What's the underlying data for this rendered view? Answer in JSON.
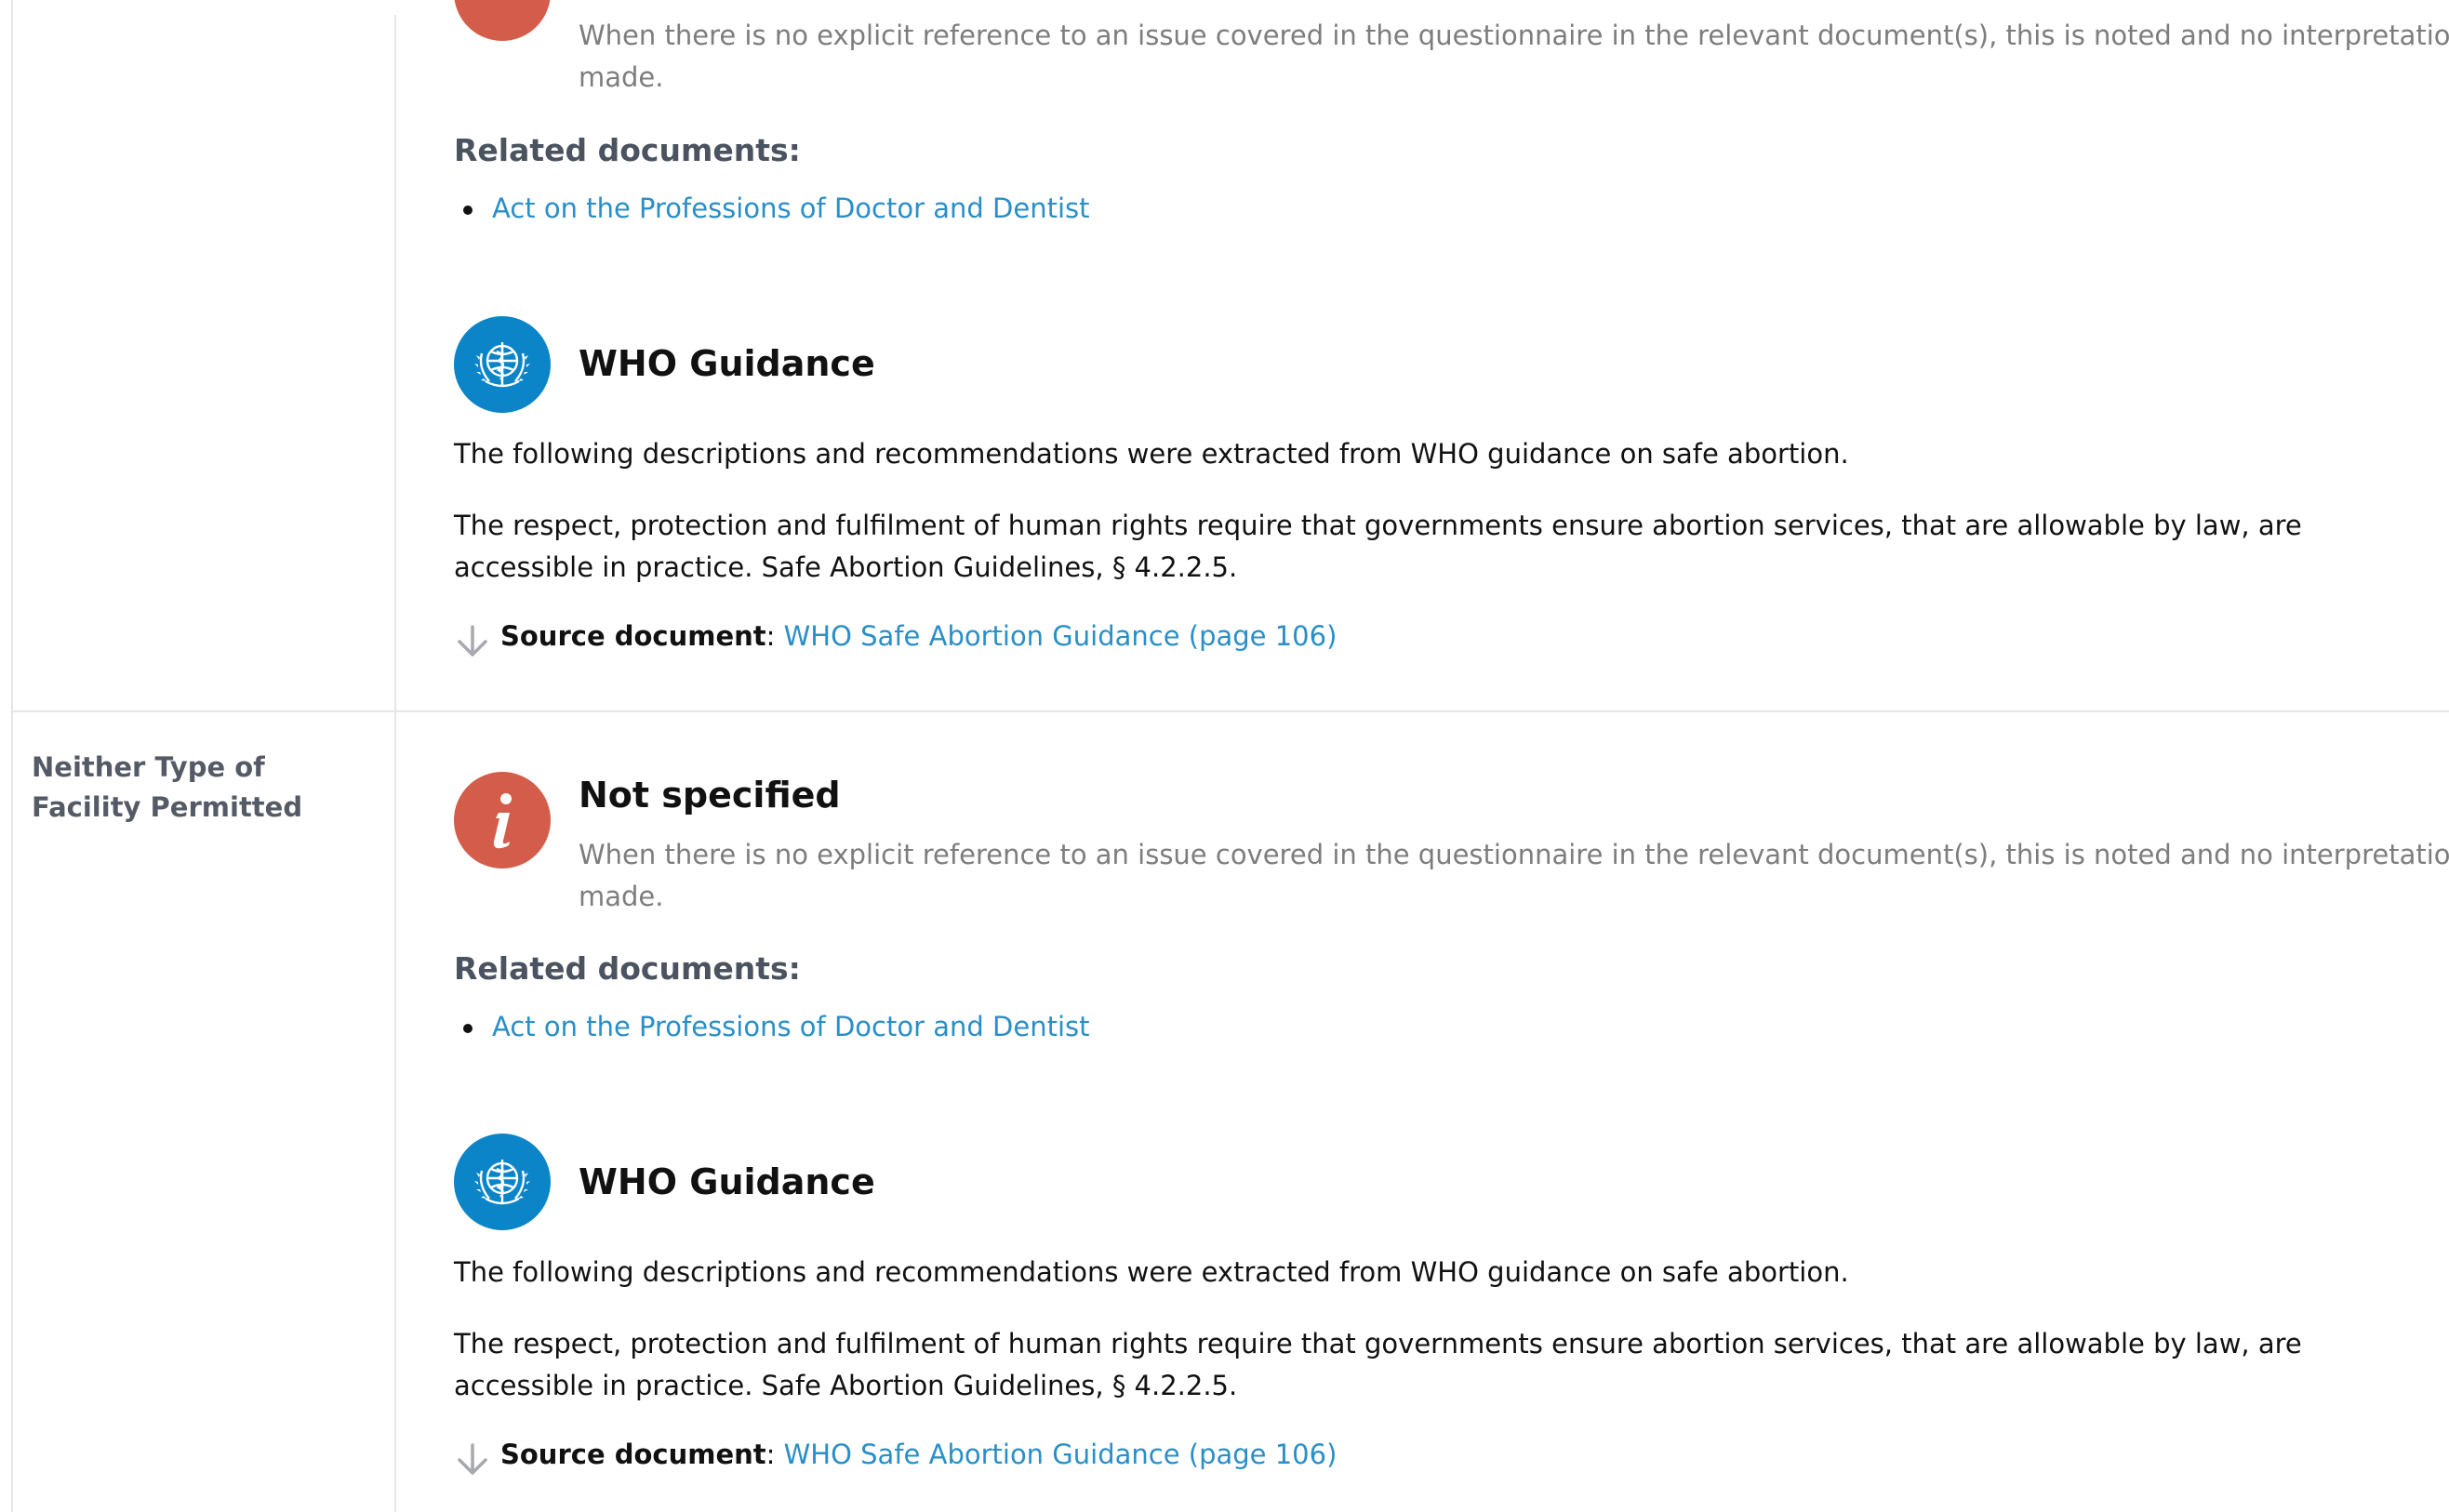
{
  "notice_text": "When there is no explicit reference to an issue covered in the questionnaire in the relevant document(s), this is noted and no interpretation was made.",
  "related_documents_label": "Related documents:",
  "related_document_link": "Act on the Professions of Doctor and Dentist",
  "who_guidance": {
    "title": "WHO Guidance",
    "intro": "The following descriptions and recommendations were extracted from WHO guidance on safe abortion.",
    "text": "The respect, protection and fulfilment of human rights require that governments ensure abortion services, that are allowable by law, are accessible in practice. Safe Abortion Guidelines, § 4.2.2.5.",
    "source_label": "Source document",
    "source_link": "WHO Safe Abortion Guidance (page 106)"
  },
  "row2": {
    "label": "Neither Type of Facility Permitted",
    "status_title": "Not specified"
  },
  "colors": {
    "status_red": "#d35d4a",
    "who_blue": "#0b84c8",
    "link_blue": "#2a8fc7"
  },
  "icons": {
    "status": "info-icon",
    "who": "who-emblem-icon",
    "source": "arrow-down-icon"
  }
}
